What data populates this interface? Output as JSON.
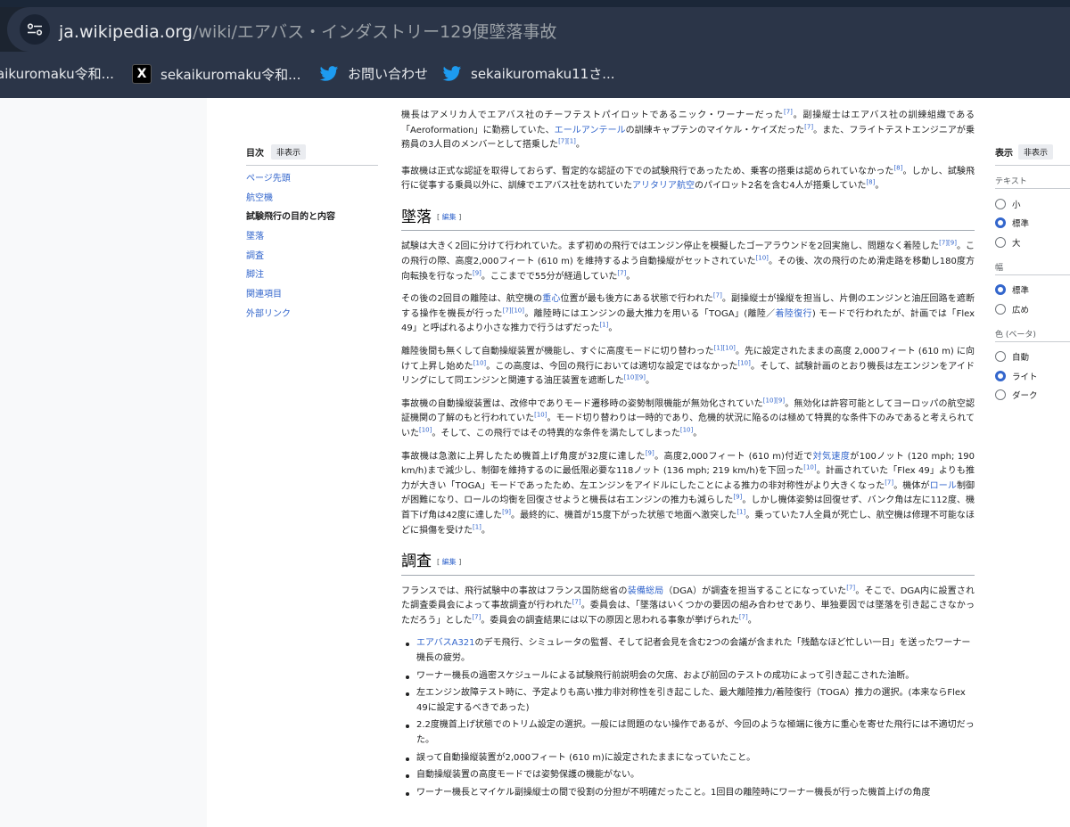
{
  "browser": {
    "url_domain": "ja.wikipedia.org",
    "url_path": "/wiki/エアバス・インダストリー129便墜落事故"
  },
  "bookmarks": [
    {
      "label": "aikuromaku令和...",
      "icon": "none"
    },
    {
      "label": "sekaikuromaku令和...",
      "icon": "x-icon"
    },
    {
      "label": "お問い合わせ",
      "icon": "twitter-bird-icon"
    },
    {
      "label": "sekaikuromaku11さ...",
      "icon": "twitter-bird-icon"
    }
  ],
  "toc": {
    "title": "目次",
    "hide_label": "非表示",
    "items": [
      "ページ先頭",
      "航空機",
      "試験飛行の目的と内容",
      "墜落",
      "調査",
      "脚注",
      "関連項目",
      "外部リンク"
    ],
    "active_index": 2
  },
  "appearance": {
    "title": "表示",
    "hide_label": "非表示",
    "text_label": "テキスト",
    "text_options": [
      "小",
      "標準",
      "大"
    ],
    "text_selected": "標準",
    "width_label": "幅",
    "width_options": [
      "標準",
      "広め"
    ],
    "width_selected": "標準",
    "color_label": "色 (ベータ)",
    "color_options": [
      "自動",
      "ライト",
      "ダーク"
    ],
    "color_selected": "ライト"
  },
  "article": {
    "edit_open": "[",
    "edit_label": "編集",
    "edit_close": "]",
    "p_crew": [
      "機長はアメリカ人でエアバス社のチーフテストパイロットであるニック・ワーナーだった",
      "[7]",
      "。副操縦士はエアバス社の訓練組織である「Aeroformation」に勤務していた、",
      "エールアンテール",
      "の訓練キャプテンのマイケル・ケイズだった",
      "[7]",
      "。また、フライトテストエンジニアが乗務員の3人目のメンバーとして搭乗した",
      "[7][1]",
      "。"
    ],
    "p_passengers": [
      "事故機は正式な認証を取得しておらず、暫定的な認証の下での試験飛行であったため、乗客の搭乗は認められていなかった",
      "[8]",
      "。しかし、試験飛行に従事する乗員以外に、訓練でエアバス社を訪れていた",
      "アリタリア航空",
      "のパイロット2名を含む4人が搭乗していた",
      "[8]",
      "。"
    ],
    "h_crash": "墜落",
    "p_crash1": [
      "試験は大きく2回に分けて行われていた。まず初めの飛行ではエンジン停止を模擬したゴーアラウンドを2回実施し、問題なく着陸した",
      "[7][9]",
      "。この飛行の際、高度2,000フィート (610 m) を維持するよう自動操縦がセットされていた",
      "[10]",
      "。その後、次の飛行のため滑走路を移動し180度方向転換を行なった",
      "[9]",
      "。ここまでで55分が経過していた",
      "[7]",
      "。"
    ],
    "p_crash2": [
      "その後の2回目の離陸は、航空機の",
      "重心",
      "位置が最も後方にある状態で行われた",
      "[7]",
      "。副操縦士が操縦を担当し、片側のエンジンと油圧回路を遮断する操作を機長が行った",
      "[7][10]",
      "。離陸時にはエンジンの最大推力を用いる「TOGA」(離陸／",
      "着陸復行",
      ") モードで行われたが、計画では「Flex 49」と呼ばれるより小さな推力で行うはずだった",
      "[1]",
      "。"
    ],
    "p_crash3": [
      "離陸後間も無くして自動操縦装置が機能し、すぐに高度モードに切り替わった",
      "[1][10]",
      "。先に設定されたままの高度 2,000フィート (610 m) に向けて上昇し始めた",
      "[10]",
      "。この高度は、今回の飛行においては適切な設定ではなかった",
      "[10]",
      "。そして、試験計画のとおり機長は左エンジンをアイドリングにして同エンジンと関連する油圧装置を遮断した",
      "[10][9]",
      "。"
    ],
    "p_crash4": [
      "事故機の自動操縦装置は、改修中でありモード遷移時の姿勢制限機能が無効化されていた",
      "[10][9]",
      "。無効化は許容可能としてヨーロッパの航空認証機関の了解のもと行われていた",
      "[10]",
      "。モード切り替わりは一時的であり、危機的状況に陥るのは極めて特異的な条件下のみであると考えられていた",
      "[10]",
      "。そして、この飛行ではその特異的な条件を満たしてしまった",
      "[10]",
      "。"
    ],
    "p_crash5": [
      "事故機は急激に上昇したため機首上げ角度が32度に達した",
      "[9]",
      "。高度2,000フィート (610 m)付近で",
      "対気速度",
      "が100ノット (120 mph; 190 km/h)まで減少し、制御を維持するのに最低限必要な118ノット (136 mph; 219 km/h)を下回った",
      "[10]",
      "。計画されていた「Flex 49」よりも推力が大きい「TOGA」モードであったため、左エンジンをアイドルにしたことによる推力の非対称性がより大きくなった",
      "[7]",
      "。機体が",
      "ロール",
      "制御が困難になり、ロールの均衡を回復させようと機長は右エンジンの推力も減らした",
      "[9]",
      "。しかし機体姿勢は回復せず、バンク角は左に112度、機首下げ角は42度に達した",
      "[9]",
      "。最終的に、機首が15度下がった状態で地面へ激突した",
      "[1]",
      "。乗っていた7人全員が死亡し、航空機は修理不可能なほどに損傷を受けた",
      "[1]",
      "。"
    ],
    "h_investigation": "調査",
    "p_inv": [
      "フランスでは、飛行試験中の事故はフランス国防総省の",
      "装備総局",
      "（DGA）が調査を担当することになっていた",
      "[7]",
      "。そこで、DGA内に設置された調査委員会によって事故調査が行われた",
      "[7]",
      "。委員会は、「墜落はいくつかの要因の組み合わせであり、単独要因では墜落を引き起こさなかっただろう」とした",
      "[7]",
      "。委員会の調査結果には以下の原因と思われる事象が挙げられた",
      "[7]",
      "。"
    ],
    "causes_first": [
      "エアバスA321",
      "のデモ飛行、シミュレータの監督、そして記者会見を含む2つの会議が含まれた「残酷なほど忙しい一日」を送ったワーナー機長の疲労。"
    ],
    "causes": [
      "ワーナー機長の過密スケジュールによる試験飛行前説明会の欠席、および前回のテストの成功によって引き起こされた油断。",
      "左エンジン故障テスト時に、予定よりも高い推力非対称性を引き起こした、最大離陸推力/着陸復行（TOGA）推力の選択。(本来ならFlex 49に設定するべきであった)",
      "2.2度機首上げ状態でのトリム設定の選択。一般には問題のない操作であるが、今回のような極端に後方に重心を寄せた飛行には不適切だった。",
      "誤って自動操縦装置が2,000フィート (610 m)に設定されたままになっていたこと。",
      "自動操縦装置の高度モードでは姿勢保護の機能がない。",
      "ワーナー機長とマイケル副操縦士の間で役割の分担が不明確だったこと。1回目の離陸時にワーナー機長が行った機首上げの角度"
    ]
  }
}
